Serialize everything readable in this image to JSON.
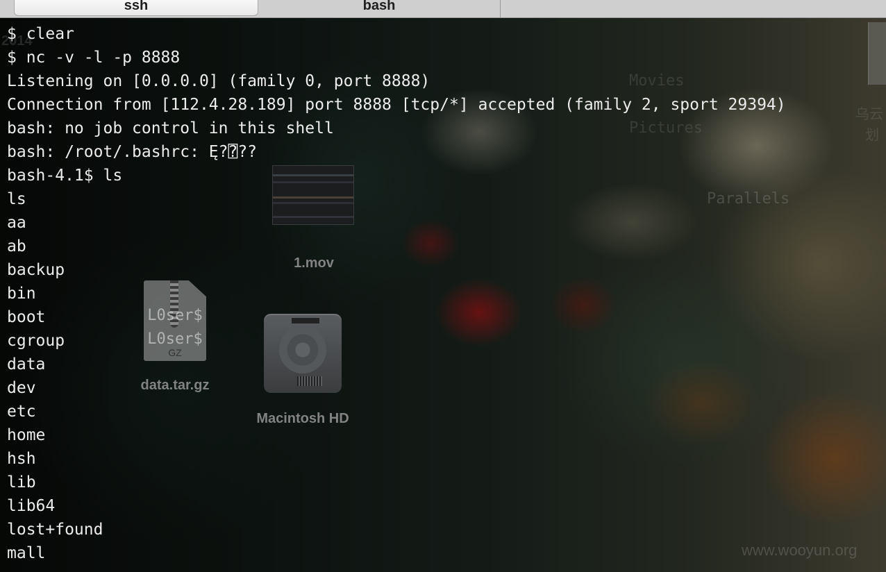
{
  "tabs": [
    {
      "label": "ssh",
      "active": true
    },
    {
      "label": "bash",
      "active": false
    }
  ],
  "terminal": {
    "lines": [
      "$ clear",
      "$ nc -v -l -p 8888",
      "Listening on [0.0.0.0] (family 0, port 8888)",
      "Connection from [112.4.28.189] port 8888 [tcp/*] accepted (family 2, sport 29394)",
      "bash: no job control in this shell",
      "bash: /root/.bashrc: Ę?⍰??",
      "bash-4.1$ ls",
      "ls",
      "aa",
      "ab",
      "backup",
      "bin",
      "boot",
      "cgroup",
      "data",
      "dev",
      "etc",
      "home",
      "hsh",
      "lib",
      "lib64",
      "lost+found",
      "mall"
    ]
  },
  "desktop": {
    "faint_labels": {
      "year": "2014",
      "movies": "Movies",
      "pictures": "Pictures",
      "parallels": "Parallels",
      "side_text_1": "乌云",
      "side_text_2": "划"
    },
    "icons": {
      "movie": {
        "label": "1.mov",
        "icon": "video-thumbnail-icon"
      },
      "archive": {
        "label": "data.tar.gz",
        "icon": "gz-archive-icon",
        "badge": "GZ",
        "overlay_text_1": "L0ser$",
        "overlay_text_2": "L0ser$"
      },
      "disk": {
        "label": "Macintosh HD",
        "icon": "hard-drive-icon"
      }
    },
    "watermark": "www.wooyun.org"
  },
  "colors": {
    "terminal_text": "#ececec",
    "tabbar_bg": "#cfcfcf",
    "active_tab_bg": "#f2f2f2",
    "icon_label": "#969696"
  }
}
